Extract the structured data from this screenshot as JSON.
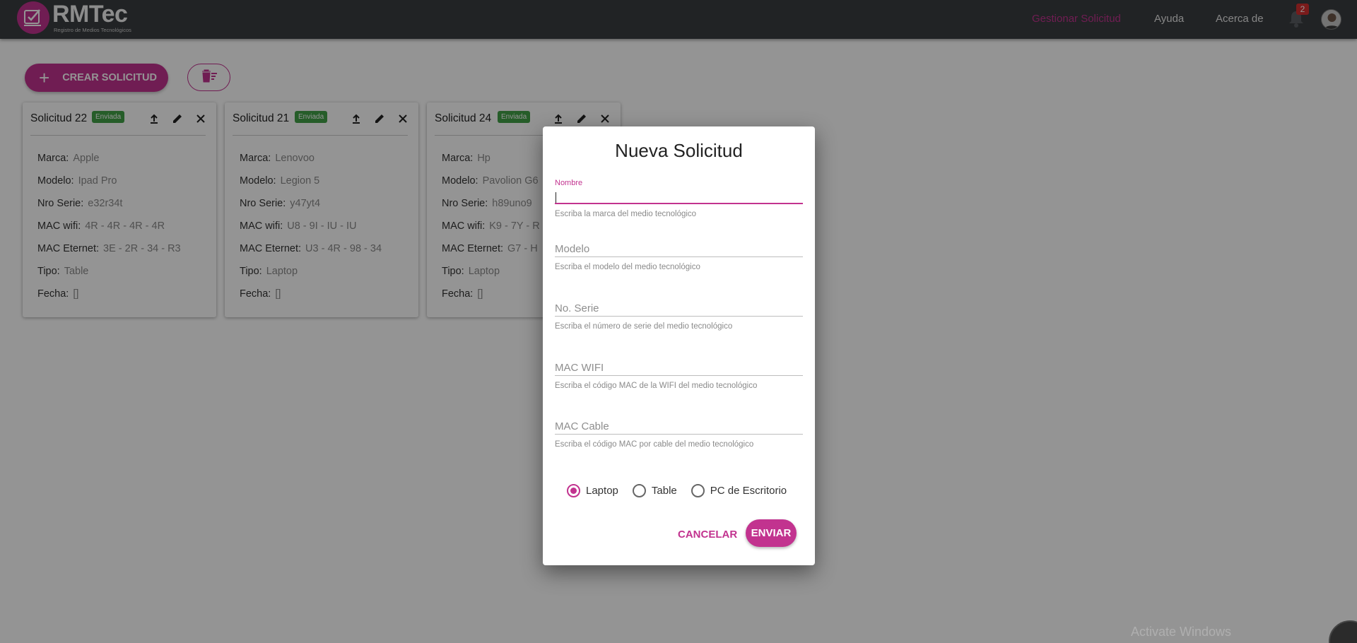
{
  "app": {
    "title": "RMTec",
    "subtitle": "Registro de Medios Tecnológicos"
  },
  "nav": {
    "items": [
      {
        "label": "Gestionar Solicitud",
        "active": true
      },
      {
        "label": "Ayuda",
        "active": false
      },
      {
        "label": "Acerca de",
        "active": false
      }
    ],
    "notification_count": "2"
  },
  "toolbar": {
    "create_label": "CREAR SOLICITUD",
    "create_icon": "plus-icon",
    "delete_all_icon": "delete-sweep-icon"
  },
  "cards": [
    {
      "title": "Solicitud 22",
      "status": "Enviada",
      "fields": [
        {
          "label": "Marca:",
          "value": "Apple"
        },
        {
          "label": "Modelo:",
          "value": "Ipad Pro"
        },
        {
          "label": "Nro Serie:",
          "value": "e32r34t"
        },
        {
          "label": "MAC wifi:",
          "value": "4R - 4R - 4R - 4R"
        },
        {
          "label": "MAC Eternet:",
          "value": "3E - 2R - 34 - R3"
        },
        {
          "label": "Tipo:",
          "value": "Table"
        },
        {
          "label": "Fecha:",
          "value": "[]"
        }
      ]
    },
    {
      "title": "Solicitud 21",
      "status": "Enviada",
      "fields": [
        {
          "label": "Marca:",
          "value": "Lenovoo"
        },
        {
          "label": "Modelo:",
          "value": "Legion 5"
        },
        {
          "label": "Nro Serie:",
          "value": "y47yt4"
        },
        {
          "label": "MAC wifi:",
          "value": "U8 - 9I - IU - IU"
        },
        {
          "label": "MAC Eternet:",
          "value": "U3 - 4R - 98 - 34"
        },
        {
          "label": "Tipo:",
          "value": "Laptop"
        },
        {
          "label": "Fecha:",
          "value": "[]"
        }
      ]
    },
    {
      "title": "Solicitud 24",
      "status": "Enviada",
      "fields": [
        {
          "label": "Marca:",
          "value": "Hp"
        },
        {
          "label": "Modelo:",
          "value": "Pavolion G6"
        },
        {
          "label": "Nro Serie:",
          "value": "h89uno9"
        },
        {
          "label": "MAC wifi:",
          "value": "K9 - 7Y - R"
        },
        {
          "label": "MAC Eternet:",
          "value": "G7 - H"
        },
        {
          "label": "Tipo:",
          "value": "Laptop"
        },
        {
          "label": "Fecha:",
          "value": "[]"
        }
      ]
    }
  ],
  "dialog": {
    "title": "Nueva Solicitud",
    "fields": [
      {
        "label": "Nombre",
        "value": "",
        "helper": "Escriba la marca del medio tecnológico"
      },
      {
        "label": "Modelo",
        "value": "",
        "helper": "Escriba el modelo del medio tecnológico"
      },
      {
        "label": "No. Serie",
        "value": "",
        "helper": "Escriba el número de serie del medio tecnológico"
      },
      {
        "label": "MAC WIFI",
        "value": "",
        "helper": "Escriba el código MAC de la WIFI del medio tecnológico"
      },
      {
        "label": "MAC Cable",
        "value": "",
        "helper": "Escriba el código MAC por cable del medio tecnológico"
      }
    ],
    "device_types": [
      {
        "label": "Laptop",
        "checked": true
      },
      {
        "label": "Table",
        "checked": false
      },
      {
        "label": "PC de Escritorio",
        "checked": false
      }
    ],
    "cancel_label": "CANCELAR",
    "submit_label": "ENVIAR"
  },
  "os": {
    "watermark": "Activate Windows"
  },
  "colors": {
    "accent": "#c2338f",
    "topbar": "#3a3d41",
    "status_green": "#43a047"
  }
}
